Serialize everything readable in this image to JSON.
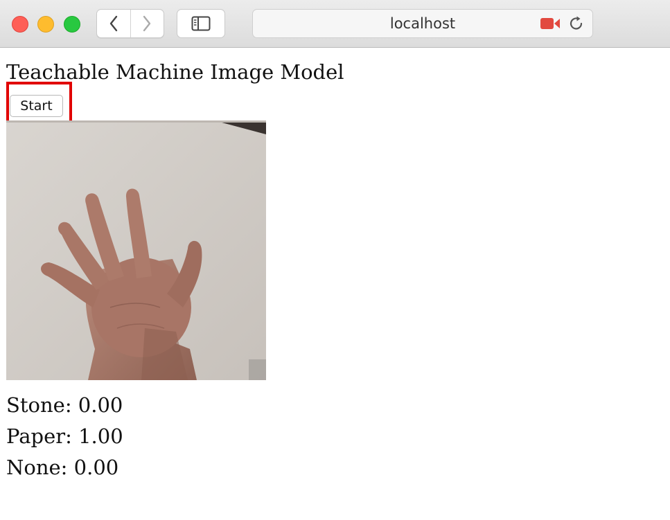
{
  "browser": {
    "address": "localhost",
    "traffic_colors": {
      "close": "#fe5f57",
      "minimize": "#febc2e",
      "zoom": "#28c840"
    },
    "icons": [
      "back-chevron-icon",
      "forward-chevron-icon",
      "sidebar-icon",
      "camera-recording-icon",
      "reload-icon"
    ],
    "camera_color": "#e2493f"
  },
  "page": {
    "title": "Teachable Machine Image Model",
    "start_label": "Start",
    "highlight_color": "#e10000",
    "webcam": {
      "content": "photo of an open hand against a light wall"
    },
    "labels": [
      {
        "text": "Stone: 0.00"
      },
      {
        "text": "Paper: 1.00"
      },
      {
        "text": "None: 0.00"
      }
    ]
  }
}
